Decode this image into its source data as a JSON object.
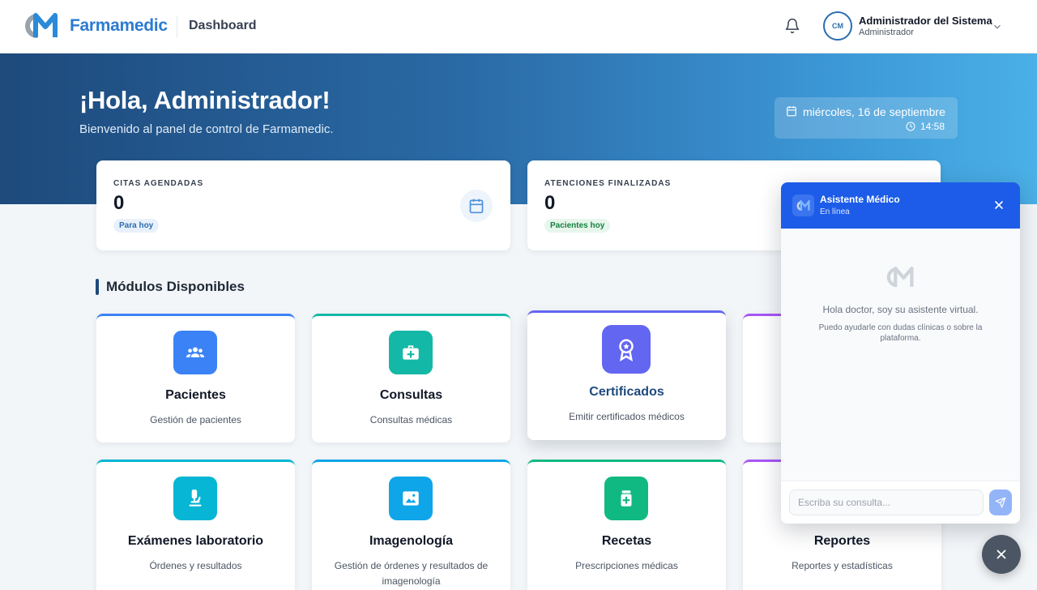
{
  "header": {
    "brand": "Farmamedic",
    "page_title": "Dashboard",
    "user_name": "Administrador del Sistema",
    "user_role": "Administrador",
    "avatar_text": "CM"
  },
  "hero": {
    "greeting": "¡Hola, Administrador!",
    "subtitle": "Bienvenido al panel de control de Farmamedic.",
    "date": "miércoles, 16 de septiembre",
    "time": "14:58"
  },
  "stats": [
    {
      "label": "CITAS AGENDADAS",
      "value": "0",
      "badge": "Para hoy",
      "badge_color": "#2b6cb0",
      "badge_bg": "#e8f1fb"
    },
    {
      "label": "ATENCIONES FINALIZADAS",
      "value": "0",
      "badge": "Pacientes hoy",
      "badge_color": "#15803d",
      "badge_bg": "#e7f6ec"
    }
  ],
  "section_title": "Módulos Disponibles",
  "modules": [
    {
      "title": "Pacientes",
      "subtitle": "Gestión de pacientes",
      "icon": "users-icon",
      "color": "#3b82f6"
    },
    {
      "title": "Consultas",
      "subtitle": "Consultas médicas",
      "icon": "medkit-icon",
      "color": "#14b8a6"
    },
    {
      "title": "Certificados",
      "subtitle": "Emitir certificados médicos",
      "icon": "award-icon",
      "color": "#6366f1"
    },
    {
      "title": "",
      "subtitle": "",
      "icon": "",
      "color": "#a855f7"
    },
    {
      "title": "Exámenes laboratorio",
      "subtitle": "Órdenes y resultados",
      "icon": "microscope-icon",
      "color": "#06b6d4"
    },
    {
      "title": "Imagenología",
      "subtitle": "Gestión de órdenes y resultados de imagenología",
      "icon": "image-icon",
      "color": "#0ea5e9"
    },
    {
      "title": "Recetas",
      "subtitle": "Prescripciones médicas",
      "icon": "prescription-icon",
      "color": "#10b981"
    },
    {
      "title": "Reportes",
      "subtitle": "Reportes y estadísticas",
      "icon": "report-icon",
      "color": "#a855f7"
    }
  ],
  "chat": {
    "title": "Asistente Médico",
    "status": "En línea",
    "welcome": "Hola doctor, soy su asistente virtual.",
    "help": "Puedo ayudarle con dudas clínicas o sobre la plataforma.",
    "placeholder": "Escriba su consulta..."
  },
  "colors": {
    "primary": "#1e4a7c",
    "accent": "#2b7bd0",
    "chat_header": "#1d5ce8"
  }
}
